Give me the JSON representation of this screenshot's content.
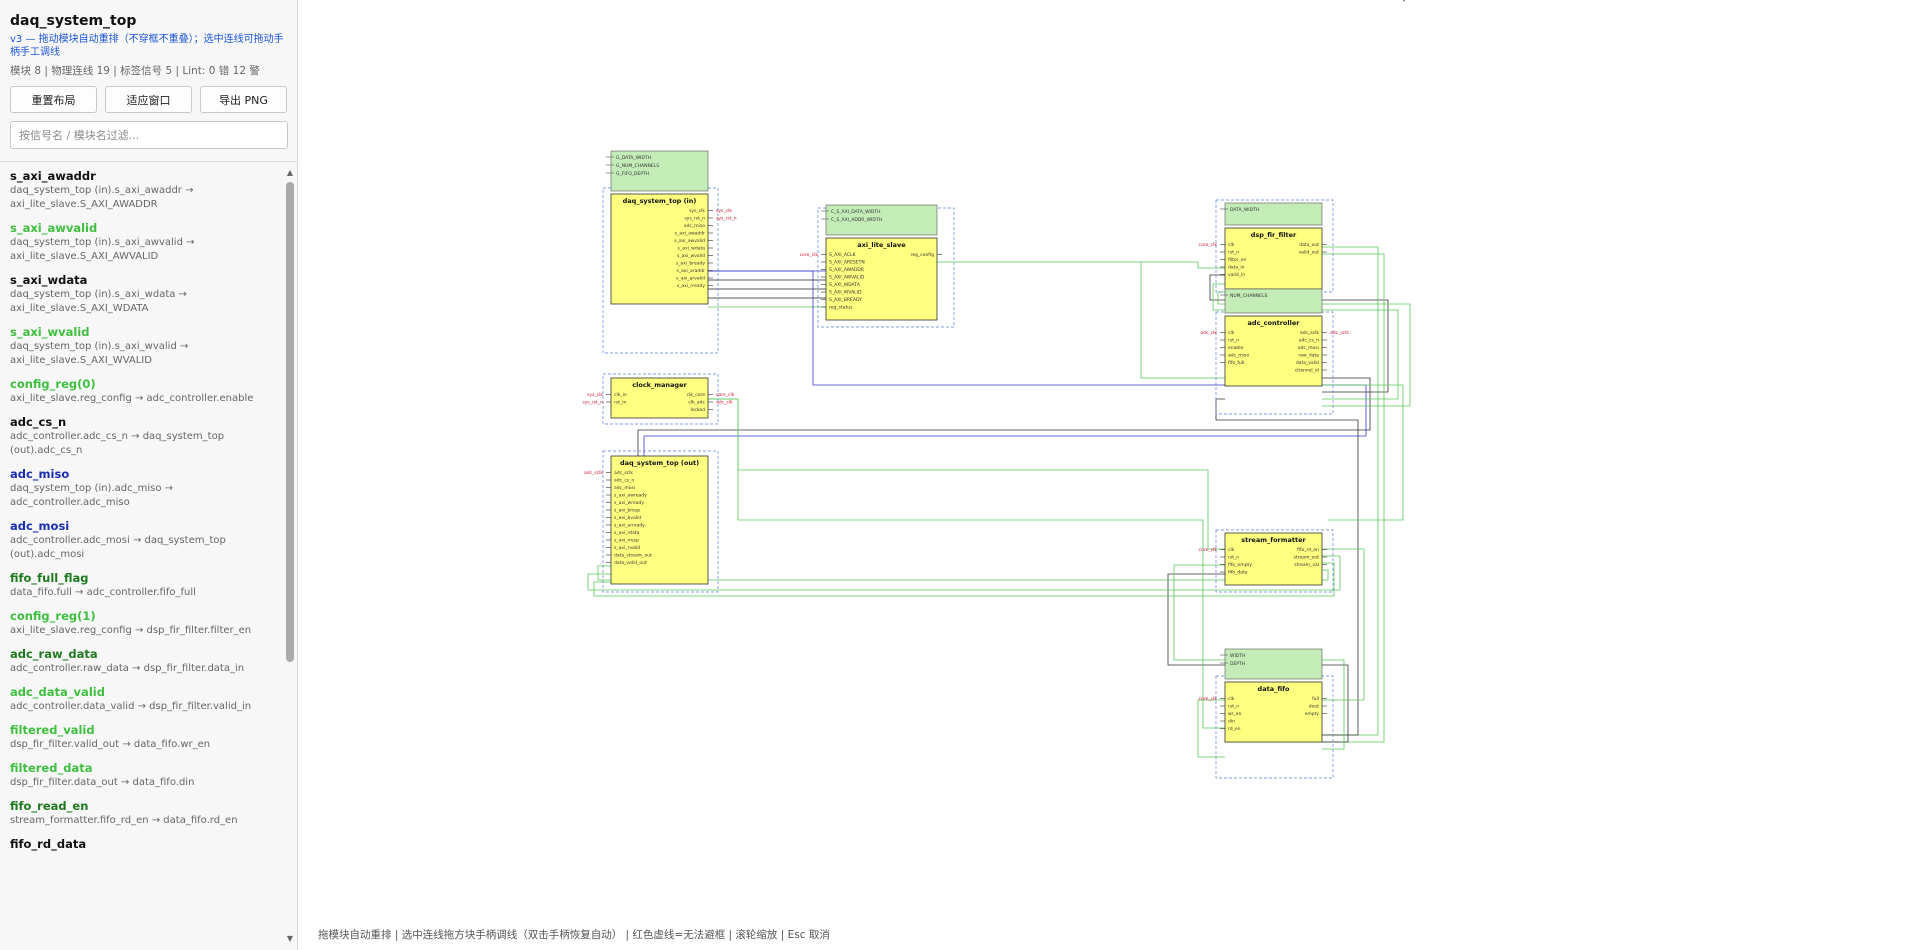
{
  "app": {
    "title": "daq_system_top",
    "subtitle": "v3 — 拖动模块自动重排（不穿框不重叠）；选中连线可拖动手柄手工调线",
    "stats": "模块 8 | 物理连线 19 | 标签信号 5 | Lint: 0 错 12 警"
  },
  "toolbar": {
    "relayout": "重置布局",
    "fit": "适应窗口",
    "export": "导出 PNG"
  },
  "filter": {
    "placeholder": "按信号名 / 模块名过滤..."
  },
  "signals": [
    {
      "name": "s_axi_awaddr",
      "desc": "daq_system_top (in).s_axi_awaddr → axi_lite_slave.S_AXI_AWADDR",
      "color": "#111111"
    },
    {
      "name": "s_axi_awvalid",
      "desc": "daq_system_top (in).s_axi_awvalid → axi_lite_slave.S_AXI_AWVALID",
      "color": "#3fbf3f"
    },
    {
      "name": "s_axi_wdata",
      "desc": "daq_system_top (in).s_axi_wdata → axi_lite_slave.S_AXI_WDATA",
      "color": "#111111"
    },
    {
      "name": "s_axi_wvalid",
      "desc": "daq_system_top (in).s_axi_wvalid → axi_lite_slave.S_AXI_WVALID",
      "color": "#3fbf3f"
    },
    {
      "name": "config_reg(0)",
      "desc": "axi_lite_slave.reg_config → adc_controller.enable",
      "color": "#3fbf3f"
    },
    {
      "name": "adc_cs_n",
      "desc": "adc_controller.adc_cs_n → daq_system_top (out).adc_cs_n",
      "color": "#111111"
    },
    {
      "name": "adc_miso",
      "desc": "daq_system_top (in).adc_miso → adc_controller.adc_miso",
      "color": "#1a2fb0"
    },
    {
      "name": "adc_mosi",
      "desc": "adc_controller.adc_mosi → daq_system_top (out).adc_mosi",
      "color": "#1a2fb0"
    },
    {
      "name": "fifo_full_flag",
      "desc": "data_fifo.full → adc_controller.fifo_full",
      "color": "#1f7a1f"
    },
    {
      "name": "config_reg(1)",
      "desc": "axi_lite_slave.reg_config → dsp_fir_filter.filter_en",
      "color": "#3fbf3f"
    },
    {
      "name": "adc_raw_data",
      "desc": "adc_controller.raw_data → dsp_fir_filter.data_in",
      "color": "#1f7a1f"
    },
    {
      "name": "adc_data_valid",
      "desc": "adc_controller.data_valid → dsp_fir_filter.valid_in",
      "color": "#3fbf3f"
    },
    {
      "name": "filtered_valid",
      "desc": "dsp_fir_filter.valid_out → data_fifo.wr_en",
      "color": "#3fbf3f"
    },
    {
      "name": "filtered_data",
      "desc": "dsp_fir_filter.data_out → data_fifo.din",
      "color": "#3fbf3f"
    },
    {
      "name": "fifo_read_en",
      "desc": "stream_formatter.fifo_rd_en → data_fifo.rd_en",
      "color": "#1f7a1f"
    },
    {
      "name": "fifo_rd_data",
      "desc": "",
      "color": "#111111"
    }
  ],
  "colors": {
    "module_fill": "#ffff80",
    "param_fill": "#c3ecb7",
    "wire_green": "#5ac85a",
    "wire_blue": "#3a3ad0",
    "wire_dark": "#333333",
    "port_red": "#d0142c",
    "frame": "#5a7fd8"
  },
  "modules": [
    {
      "id": "top_in",
      "name": "daq_system_top (in)",
      "params": [
        "G_DATA_WIDTH",
        "G_NUM_CHANNELS",
        "G_FIFO_DEPTH"
      ],
      "left": [],
      "right": [
        "sys_clk",
        "sys_rst_n",
        "adc_miso",
        "s_axi_awaddr",
        "s_axi_awvalid",
        "s_axi_wdata",
        "s_axi_wvalid",
        "s_axi_bready",
        "s_axi_araddr",
        "s_axi_arvalid",
        "s_axi_rready"
      ],
      "rightExt": [
        "sys_clk",
        "sys_rst_n"
      ]
    },
    {
      "id": "axi",
      "name": "axi_lite_slave",
      "params": [
        "C_S_AXI_DATA_WIDTH",
        "C_S_AXI_ADDR_WIDTH"
      ],
      "left": [
        "S_AXI_ACLK",
        "S_AXI_ARESETN",
        "S_AXI_AWADDR",
        "S_AXI_AWVALID",
        "S_AXI_WDATA",
        "S_AXI_WVALID",
        "S_AXI_BREADY",
        "reg_status"
      ],
      "right": [
        "reg_config"
      ],
      "leftExt": [
        "core_clk"
      ]
    },
    {
      "id": "dsp",
      "name": "dsp_fir_filter",
      "params": [
        "DATA_WIDTH"
      ],
      "left": [
        "clk",
        "rst_n",
        "filter_en",
        "data_in",
        "valid_in"
      ],
      "right": [
        "data_out",
        "valid_out"
      ],
      "leftExt": [
        "core_clk"
      ]
    },
    {
      "id": "adc",
      "name": "adc_controller",
      "params": [
        "NUM_CHANNELS"
      ],
      "left": [
        "clk",
        "rst_n",
        "enable",
        "adc_miso",
        "fifo_full"
      ],
      "right": [
        "adc_sclk",
        "adc_cs_n",
        "adc_mosi",
        "raw_data",
        "data_valid",
        "channel_id"
      ],
      "leftExt": [
        "adc_clk"
      ],
      "rightExt": [
        "adc_sclk"
      ]
    },
    {
      "id": "clk",
      "name": "clock_manager",
      "params": [],
      "left": [
        "clk_in",
        "rst_in"
      ],
      "right": [
        "clk_core",
        "clk_adc",
        "locked"
      ],
      "leftExt": [
        "sys_clk",
        "sys_rst_n"
      ],
      "rightExt": [
        "core_clk",
        "adc_clk"
      ]
    },
    {
      "id": "top_out",
      "name": "daq_system_top (out)",
      "params": [],
      "left": [
        "adc_sclk",
        "adc_cs_n",
        "adc_mosi",
        "s_axi_awready",
        "s_axi_wready",
        "s_axi_bresp",
        "s_axi_bvalid",
        "s_axi_arready",
        "s_axi_rdata",
        "s_axi_rresp",
        "s_axi_rvalid",
        "data_stream_out",
        "data_valid_out"
      ],
      "right": [],
      "leftExt": [
        "adc_sclk"
      ]
    },
    {
      "id": "fmt",
      "name": "stream_formatter",
      "params": [],
      "left": [
        "clk",
        "rst_n",
        "fifo_empty",
        "fifo_data"
      ],
      "right": [
        "fifo_rd_en",
        "stream_out",
        "stream_val"
      ],
      "leftExt": [
        "core_clk"
      ]
    },
    {
      "id": "fifo",
      "name": "data_fifo",
      "params": [
        "WIDTH",
        "DEPTH"
      ],
      "left": [
        "clk",
        "rst_n",
        "wr_en",
        "din",
        "rd_en"
      ],
      "right": [
        "full",
        "dout",
        "empty"
      ],
      "leftExt": [
        "core_clk"
      ]
    }
  ],
  "status": "拖模块自动重排 | 选中连线拖方块手柄调线（双击手柄恢复自动） | 红色虚线=无法避框 | 滚轮缩放 | Esc 取消"
}
